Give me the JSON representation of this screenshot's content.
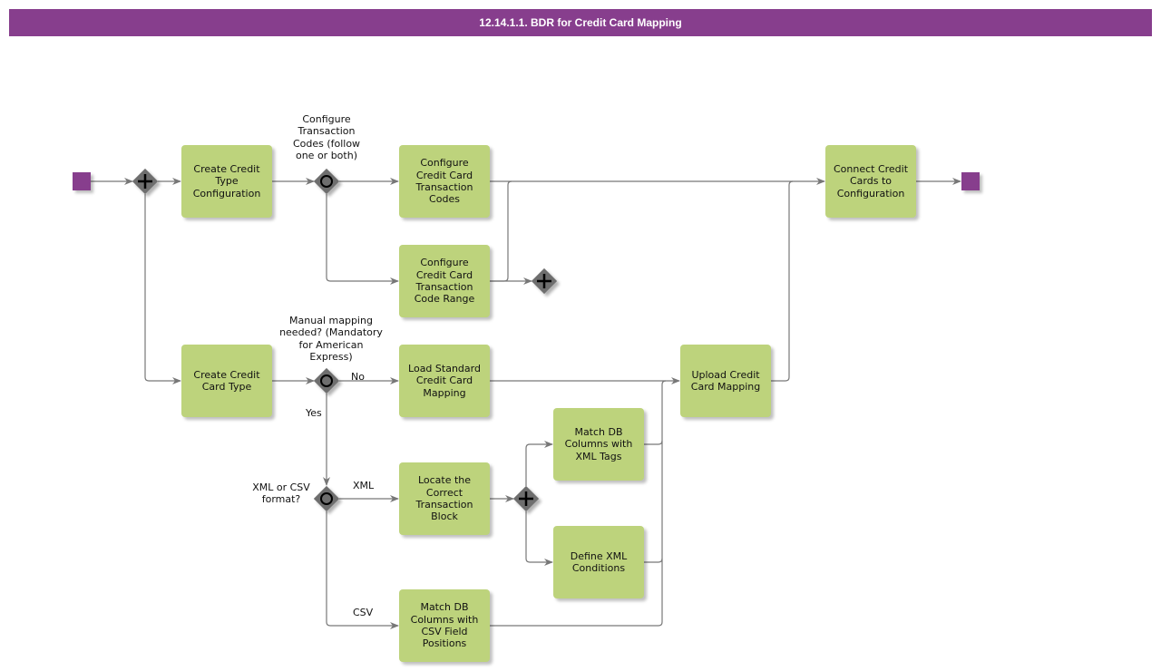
{
  "title": "12.14.1.1. BDR for Credit Card Mapping",
  "colors": {
    "header": "#873e8d",
    "event": "#873e8d",
    "task": "#bdd37c",
    "gateway": "#6e6e6e",
    "connector": "#777777"
  },
  "events": {
    "start": "start-event",
    "end": "end-event"
  },
  "tasks": {
    "create_credit_type_config": "Create Credit Type Configuration",
    "configure_cc_transaction_codes": "Configure Credit Card Transaction Codes",
    "configure_cc_transaction_code_range": "Configure Credit Card Transaction Code Range",
    "connect_credit_cards": "Connect Credit Cards to Configuration",
    "create_credit_card_type": "Create Credit Card Type",
    "load_standard_mapping": "Load Standard Credit Card Mapping",
    "upload_mapping": "Upload Credit Card Mapping",
    "match_db_xml_tags": "Match DB Columns with XML Tags",
    "locate_transaction_block": "Locate the Correct Transaction Block",
    "define_xml_conditions": "Define XML Conditions",
    "match_db_csv_positions": "Match DB Columns with CSV Field Positions"
  },
  "gateways": {
    "split_parallel": {
      "type": "parallel",
      "icon": "plus-icon"
    },
    "transaction_codes": {
      "type": "inclusive",
      "icon": "circle-icon",
      "label": "Configure Transaction Codes (follow one or both)"
    },
    "join_parallel": {
      "type": "parallel",
      "icon": "plus-icon"
    },
    "manual_mapping": {
      "type": "inclusive",
      "icon": "circle-icon",
      "label": "Manual mapping needed? (Mandatory for American Express)"
    },
    "format": {
      "type": "inclusive",
      "icon": "circle-icon",
      "label": "XML or CSV format?"
    },
    "xml_parallel": {
      "type": "parallel",
      "icon": "plus-icon"
    }
  },
  "flow_labels": {
    "no": "No",
    "yes": "Yes",
    "xml": "XML",
    "csv": "CSV"
  }
}
